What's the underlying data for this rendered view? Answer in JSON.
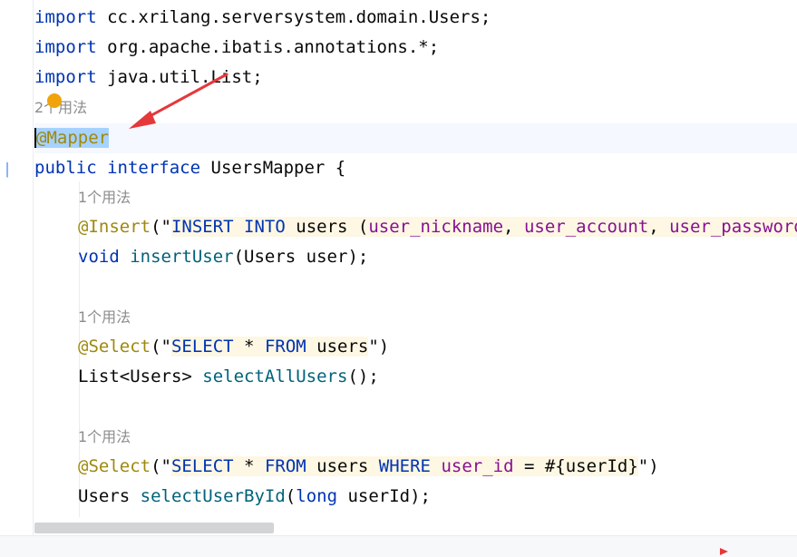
{
  "editor": {
    "imports": [
      {
        "keyword": "import",
        "path": "cc.xrilang.serversystem.domain.Users;"
      },
      {
        "keyword": "import",
        "path": "org.apache.ibatis.annotations.*;"
      },
      {
        "keyword": "import",
        "path": "java.util.List;"
      }
    ],
    "usage_hint_class": "2个用法",
    "mapper_annotation": "@Mapper",
    "interface_decl": {
      "kw1": "public",
      "kw2": "interface",
      "name": "UsersMapper",
      "brace": " {"
    },
    "methods": [
      {
        "hint": "1个用法",
        "annotation": "@Insert",
        "sql": [
          {
            "t": "(\"",
            "c": "plain"
          },
          {
            "t": "INSERT INTO",
            "c": "sqlkw"
          },
          {
            "t": " users (",
            "c": "plain"
          },
          {
            "t": "user_nickname",
            "c": "col"
          },
          {
            "t": ", ",
            "c": "plain"
          },
          {
            "t": "user_account",
            "c": "col"
          },
          {
            "t": ", ",
            "c": "plain"
          },
          {
            "t": "user_password",
            "c": "col"
          }
        ],
        "signature": [
          {
            "t": "void",
            "c": "kw"
          },
          {
            "t": " ",
            "c": "plain"
          },
          {
            "t": "insertUser",
            "c": "fn"
          },
          {
            "t": "(Users user);",
            "c": "plain"
          }
        ]
      },
      {
        "hint": "1个用法",
        "annotation": "@Select",
        "sql": [
          {
            "t": "(\"",
            "c": "plain"
          },
          {
            "t": "SELECT",
            "c": "sqlkw"
          },
          {
            "t": " * ",
            "c": "plain"
          },
          {
            "t": "FROM",
            "c": "sqlkw"
          },
          {
            "t": " users",
            "c": "plain"
          },
          {
            "t": "\")",
            "c": "plain"
          }
        ],
        "signature": [
          {
            "t": "List<Users> ",
            "c": "plain"
          },
          {
            "t": "selectAllUsers",
            "c": "fn"
          },
          {
            "t": "();",
            "c": "plain"
          }
        ]
      },
      {
        "hint": "1个用法",
        "annotation": "@Select",
        "sql": [
          {
            "t": "(\"",
            "c": "plain"
          },
          {
            "t": "SELECT",
            "c": "sqlkw"
          },
          {
            "t": " * ",
            "c": "plain"
          },
          {
            "t": "FROM",
            "c": "sqlkw"
          },
          {
            "t": " users ",
            "c": "plain"
          },
          {
            "t": "WHERE",
            "c": "sqlkw"
          },
          {
            "t": " ",
            "c": "plain"
          },
          {
            "t": "user_id",
            "c": "col"
          },
          {
            "t": " = #{userId}",
            "c": "plain"
          },
          {
            "t": "\")",
            "c": "plain"
          }
        ],
        "signature": [
          {
            "t": "Users ",
            "c": "plain"
          },
          {
            "t": "selectUserById",
            "c": "fn"
          },
          {
            "t": "(",
            "c": "plain"
          },
          {
            "t": "long",
            "c": "kw"
          },
          {
            "t": " userId);",
            "c": "plain"
          }
        ]
      }
    ]
  },
  "icons": {
    "bulb": "intention-bulb-icon",
    "arrow": "red-annotation-arrow",
    "gutter": "implementation-gutter-icon",
    "status": "error-indicator-icon"
  },
  "colors": {
    "keyword": "#0033b3",
    "annotation": "#9e880d",
    "column": "#871094",
    "method": "#00627a",
    "selection": "#a6d2ff",
    "arrow": "#e5383b"
  }
}
